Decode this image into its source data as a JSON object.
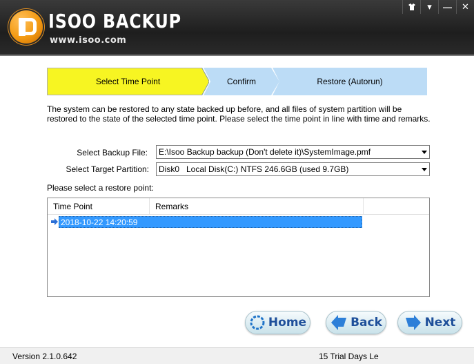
{
  "header": {
    "brand": "ISOO BACKUP",
    "url": "www.isoo.com",
    "window_buttons": [
      "▾",
      "—",
      "✕"
    ]
  },
  "steps": [
    {
      "label": "Select Time Point",
      "active": true
    },
    {
      "label": "Confirm",
      "active": false
    },
    {
      "label": "Restore (Autorun)",
      "active": false
    }
  ],
  "description": "The system can be restored to any state backed up before, and all files of system partition will be restored to the state of the selected time point. Please select the time point in line with time and remarks.",
  "backup_file": {
    "label": "Select Backup File:",
    "value": "E:\\Isoo Backup backup (Don't delete it)\\SystemImage.pmf"
  },
  "target_partition": {
    "label": "Select Target Partition:",
    "value": "Disk0   Local Disk(C:) NTFS 246.6GB (used 9.7GB)"
  },
  "restore_point_label": "Please select a restore point:",
  "list": {
    "columns": [
      "Time Point",
      "Remarks"
    ],
    "rows": [
      {
        "time_point": "2018-10-22 14:20:59",
        "remarks": ""
      }
    ]
  },
  "buttons": {
    "home": "Home",
    "back": "Back",
    "next": "Next"
  },
  "status": {
    "version": "Version 2.1.0.642",
    "trial": "15 Trial Days Le"
  },
  "colors": {
    "active_step": "#f7f522",
    "inactive_step": "#bcdcf6",
    "selection": "#3399ff",
    "button_text": "#1e4f9a"
  }
}
